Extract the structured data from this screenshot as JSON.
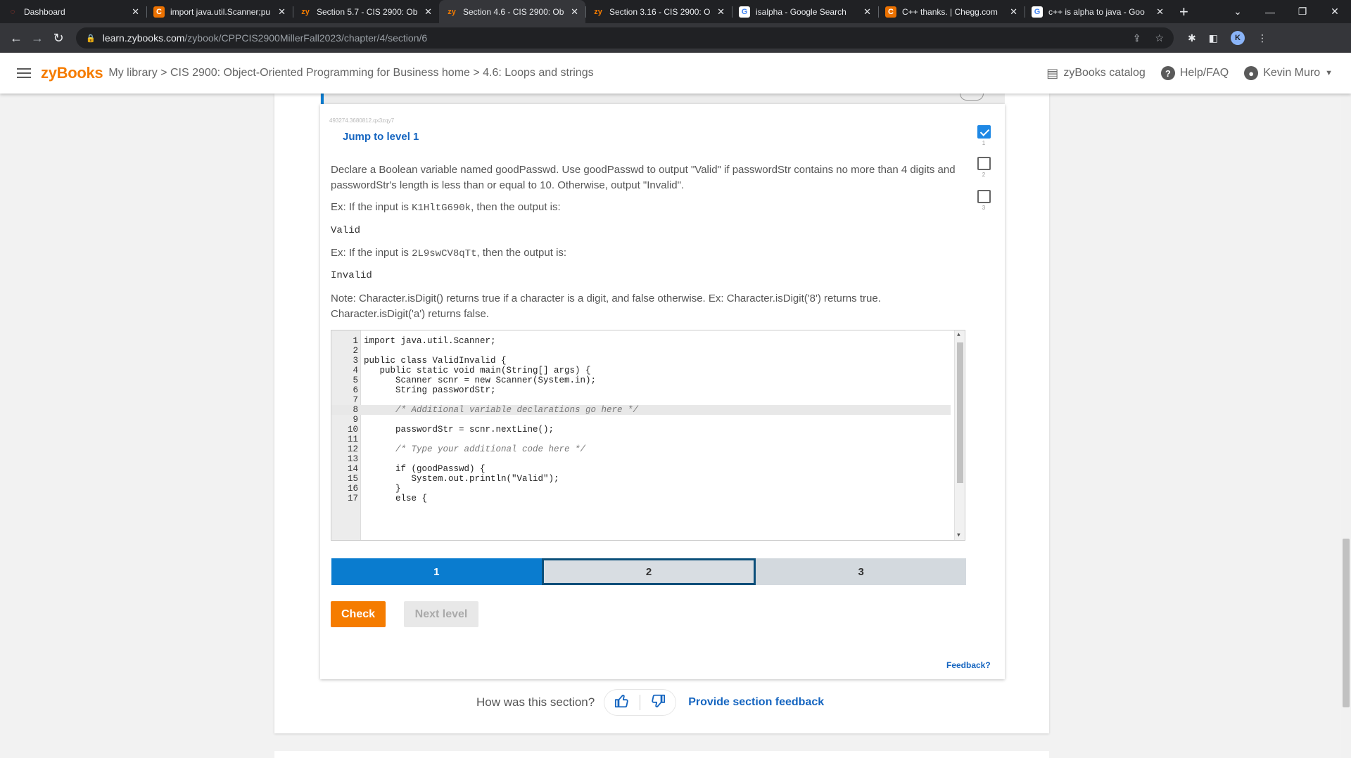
{
  "browser": {
    "tabs": [
      {
        "title": "Dashboard",
        "icon": "canvas-icon",
        "active": false
      },
      {
        "title": "import java.util.Scanner;pu",
        "icon": "chegg-icon",
        "active": false
      },
      {
        "title": "Section 5.7 - CIS 2900: Ob",
        "icon": "zybooks-icon",
        "active": false
      },
      {
        "title": "Section 4.6 - CIS 2900: Ob",
        "icon": "zybooks-icon",
        "active": true
      },
      {
        "title": "Section 3.16 - CIS 2900: O",
        "icon": "zybooks-icon",
        "active": false
      },
      {
        "title": "isalpha - Google Search",
        "icon": "google-icon",
        "active": false
      },
      {
        "title": "C++ thanks. | Chegg.com",
        "icon": "chegg-icon",
        "active": false
      },
      {
        "title": "c++ is alpha to java - Goo",
        "icon": "google-icon",
        "active": false
      }
    ],
    "new_tab": "+",
    "url_host": "learn.zybooks.com",
    "url_path": "/zybook/CPPCIS2900MillerFall2023/chapter/4/section/6",
    "profile_initial": "K"
  },
  "header": {
    "logo": "zyBooks",
    "breadcrumb": "My library > CIS 2900: Object-Oriented Programming for Business home > 4.6: Loops and strings",
    "catalog": "zyBooks catalog",
    "help": "Help/FAQ",
    "user": "Kevin Muro"
  },
  "activity": {
    "id": "493274.3680812.qx3zqy7",
    "jump": "Jump to level 1",
    "prompt": "Declare a Boolean variable named goodPasswd. Use goodPasswd to output \"Valid\" if passwordStr contains no more than 4 digits and passwordStr's length is less than or equal to 10. Otherwise, output \"Invalid\".",
    "ex1_prefix": "Ex: If the input is ",
    "ex1_input": "K1HltG690k",
    "ex1_suffix": ", then the output is:",
    "ex1_output": "Valid",
    "ex2_prefix": "Ex: If the input is ",
    "ex2_input": "2L9swCV8qTt",
    "ex2_suffix": ", then the output is:",
    "ex2_output": "Invalid",
    "note": "Note: Character.isDigit() returns true if a character is a digit, and false otherwise. Ex: Character.isDigit('8') returns true. Character.isDigit('a') returns false.",
    "levels_side": [
      {
        "num": "1",
        "done": true
      },
      {
        "num": "2",
        "done": false
      },
      {
        "num": "3",
        "done": false
      }
    ],
    "code_lines": [
      {
        "n": "1",
        "text": "import java.util.Scanner;"
      },
      {
        "n": "2",
        "text": ""
      },
      {
        "n": "3",
        "text": "public class ValidInvalid {"
      },
      {
        "n": "4",
        "text": "   public static void main(String[] args) {"
      },
      {
        "n": "5",
        "text": "      Scanner scnr = new Scanner(System.in);"
      },
      {
        "n": "6",
        "text": "      String passwordStr;"
      },
      {
        "n": "7",
        "text": ""
      },
      {
        "n": "8",
        "text": "      /* Additional variable declarations go here */"
      },
      {
        "n": "9",
        "text": ""
      },
      {
        "n": "10",
        "text": "      passwordStr = scnr.nextLine();"
      },
      {
        "n": "11",
        "text": ""
      },
      {
        "n": "12",
        "text": "      /* Type your additional code here */"
      },
      {
        "n": "13",
        "text": ""
      },
      {
        "n": "14",
        "text": "      if (goodPasswd) {"
      },
      {
        "n": "15",
        "text": "         System.out.println(\"Valid\");"
      },
      {
        "n": "16",
        "text": "      }"
      },
      {
        "n": "17",
        "text": "      else {"
      }
    ],
    "level_tabs": [
      "1",
      "2",
      "3"
    ],
    "check": "Check",
    "next": "Next level",
    "feedback": "Feedback?"
  },
  "rating": {
    "question": "How was this section?",
    "provide": "Provide section feedback"
  },
  "colors": {
    "accent_orange": "#f57c00",
    "accent_blue": "#0a7ccf",
    "link_blue": "#1565c0"
  }
}
